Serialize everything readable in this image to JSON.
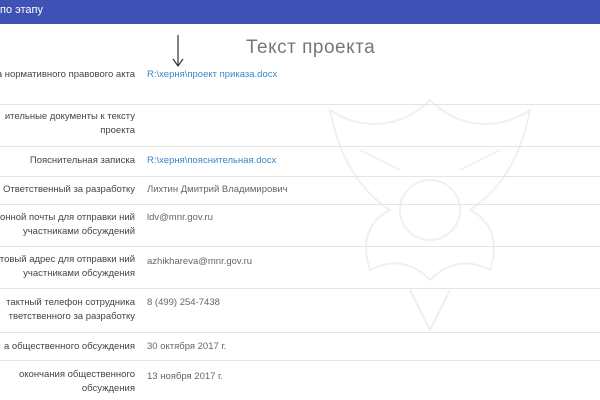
{
  "header": {
    "title": "по этапу"
  },
  "page_title": "Текст проекта",
  "rows": [
    {
      "label": "кта нормативного правового акта",
      "value": "R:\\херня\\проект приказа.docx",
      "link": true
    },
    {
      "label": "ительные документы к тексту проекта",
      "value": "",
      "link": false
    },
    {
      "label": "Пояснительная записка",
      "value": "R:\\херня\\пояснительная.docx",
      "link": true
    },
    {
      "label": "Ответственный за разработку",
      "value": "Лихтин Дмитрий Владимирович",
      "link": false
    },
    {
      "label": "тронной почты для отправки ний участниками обсуждений",
      "value": "ldv@mnr.gov.ru",
      "link": false
    },
    {
      "label": "Почтовый адрес для отправки ний участниками обсуждения",
      "value": "azhikhareva@mnr.gov.ru",
      "link": false
    },
    {
      "label": "тактный телефон сотрудника тветственного за разработку",
      "value": "8 (499) 254-7438",
      "link": false
    },
    {
      "label": "а общественного обсуждения",
      "value": "30 октября 2017 г.",
      "link": false
    },
    {
      "label": "окончания общественного обсуждения",
      "value": "13 ноября 2017 г.",
      "link": false
    }
  ],
  "icons": {
    "arrow": "arrow-down-icon",
    "watermark": "emblem-watermark"
  },
  "colors": {
    "header_bg": "#3f51b5",
    "link": "#3a87c8",
    "divider": "#e4e4e4"
  }
}
